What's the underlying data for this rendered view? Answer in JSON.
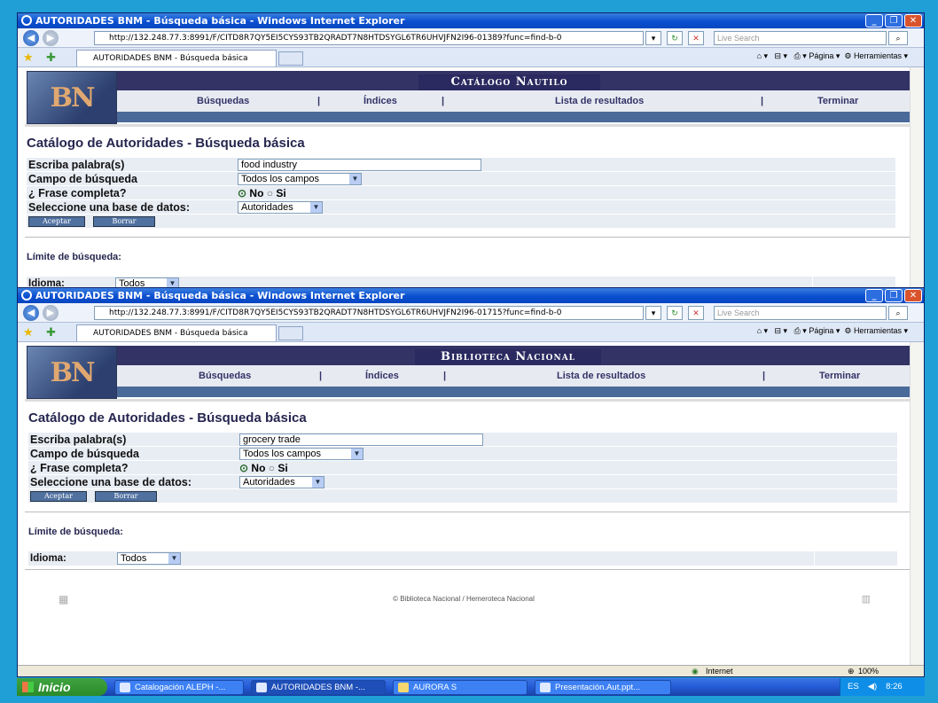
{
  "taskbar": {
    "start_label": "Inicio",
    "tasks": [
      {
        "label": "Catalogación ALEPH -..."
      },
      {
        "label": "AUTORIDADES BNM -..."
      },
      {
        "label": "AURORA S"
      },
      {
        "label": "Presentación.Aut.ppt..."
      }
    ],
    "tray": {
      "lang": "ES",
      "time": "8:26"
    }
  },
  "win1": {
    "title": "AUTORIDADES BNM - Búsqueda básica - Windows Internet Explorer",
    "url": "http://132.248.77.3:8991/F/CITD8R7QY5EI5CYS93TB2QRADT7N8HTDSYGL6TR6UHVJFN2I96-01389?func=find-b-0",
    "search_placeholder": "Live Search",
    "tab_label": "AUTORIDADES BNM - Búsqueda básica",
    "cmd_pagina": "Página",
    "cmd_herramientas": "Herramientas",
    "banner_title": "Catálogo Nautilo",
    "logo_text": "BN",
    "nav": {
      "busquedas": "Búsquedas",
      "indices": "Índices",
      "lista": "Lista de resultados",
      "terminar": "Terminar",
      "sep": "|"
    },
    "heading": "Catálogo de Autoridades - Búsqueda básica",
    "form": {
      "palabra_label": "Escriba palabra(s)",
      "palabra_value": "food industry",
      "campo_label": "Campo de búsqueda",
      "campo_value": "Todos los campos",
      "frase_label": "¿ Frase completa?",
      "no_label": "No",
      "si_label": "Si",
      "base_label": "Seleccione una base de datos:",
      "base_value": "Autoridades",
      "aceptar": "Aceptar",
      "borrar": "Borrar"
    },
    "limite": "Límite de búsqueda:",
    "idioma_label": "Idioma:",
    "idioma_value": "Todos"
  },
  "win2": {
    "title": "AUTORIDADES BNM - Búsqueda básica - Windows Internet Explorer",
    "url": "http://132.248.77.3:8991/F/CITD8R7QY5EI5CYS93TB2QRADT7N8HTDSYGL6TR6UHVJFN2I96-01715?func=find-b-0",
    "search_placeholder": "Live Search",
    "tab_label": "AUTORIDADES BNM - Búsqueda básica",
    "cmd_pagina": "Página",
    "cmd_herramientas": "Herramientas",
    "banner_title": "Biblioteca Nacional",
    "logo_text": "BN",
    "nav": {
      "busquedas": "Búsquedas",
      "indices": "Índices",
      "lista": "Lista de resultados",
      "terminar": "Terminar",
      "sep": "|"
    },
    "heading": "Catálogo de Autoridades - Búsqueda básica",
    "form": {
      "palabra_label": "Escriba palabra(s)",
      "palabra_value": "grocery trade",
      "campo_label": "Campo de búsqueda",
      "campo_value": "Todos los campos",
      "frase_label": "¿ Frase completa?",
      "no_label": "No",
      "si_label": "Si",
      "base_label": "Seleccione una base de datos:",
      "base_value": "Autoridades",
      "aceptar": "Aceptar",
      "borrar": "Borrar"
    },
    "limite": "Límite de búsqueda:",
    "idioma_label": "Idioma:",
    "idioma_value": "Todos",
    "footer": "© Biblioteca Nacional / Hemeroteca Nacional",
    "status_zone": "Internet",
    "status_zoom": "100%"
  }
}
